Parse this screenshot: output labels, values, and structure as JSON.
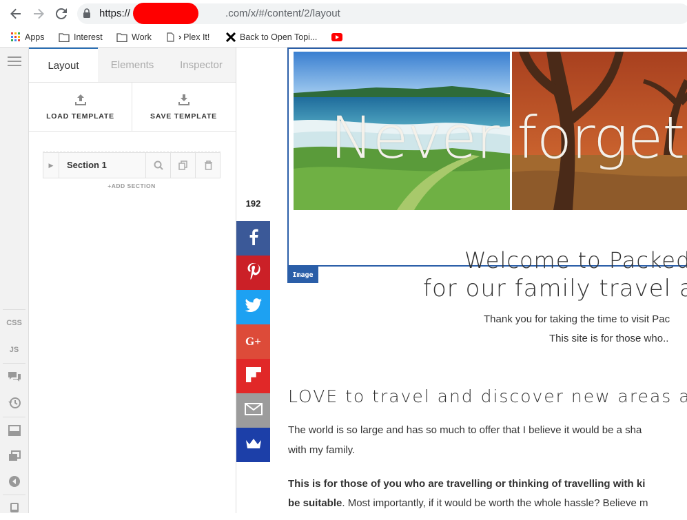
{
  "browser": {
    "url_prefix": "https://",
    "url_suffix": ".com/x/#/content/2/layout",
    "bookmarks": [
      "Apps",
      "Interest",
      "Work",
      "Plex It!",
      "Back to Open Topi..."
    ]
  },
  "rail": {
    "css_label": "CSS",
    "js_label": "JS"
  },
  "panel": {
    "tabs": [
      "Layout",
      "Elements",
      "Inspector"
    ],
    "load_template": "LOAD TEMPLATE",
    "save_template": "SAVE TEMPLATE",
    "section_label": "Section 1",
    "add_section": "+ADD SECTION"
  },
  "share": {
    "count": "192"
  },
  "canvas": {
    "hero_text": "Never forget t",
    "image_badge": "Image",
    "welcome": "Welcome to Packed",
    "family": "for our family travel a",
    "thanks": "Thank you for taking the time to visit Pac",
    "site_for": "This site is for those who..",
    "love": "LOVE to travel and discover new areas a",
    "world_line1": "The world is so large and has so much to offer that I believe it would be a sha",
    "world_line2": "with my family.",
    "bold_line1": "This is for those of you who are travelling or thinking of travelling with ki",
    "bold_line2_bold": "be suitable",
    "bold_line2_rest": ". Most importantly, if it would be worth the whole hassle? Believe m"
  },
  "colors": {
    "accent": "#2a5ea8",
    "facebook": "#3b5998",
    "pinterest": "#cb2027",
    "twitter": "#1da1f2",
    "googleplus": "#dd4b39",
    "flipboard": "#e12828",
    "email": "#9c9c9c",
    "crown": "#1c3fa8"
  }
}
